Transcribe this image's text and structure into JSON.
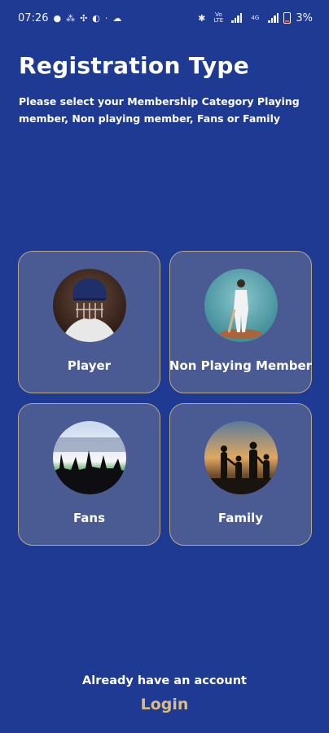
{
  "status_bar": {
    "time": "07:26",
    "network_label": "Vo LTE",
    "network_type": "4G",
    "battery": "3%",
    "left_icons": [
      "message-icon",
      "app-icon",
      "app-icon",
      "whatsapp-icon",
      "dot-icon",
      "cloud-icon"
    ]
  },
  "header": {
    "title": "Registration Type",
    "subtitle": "Please select your Membership Category Playing member, Non playing member, Fans or Family"
  },
  "categories": [
    {
      "label": "Player",
      "icon": "cricket-player-image"
    },
    {
      "label": "Non Playing Member",
      "icon": "cricket-member-image"
    },
    {
      "label": "Fans",
      "icon": "stadium-fans-image"
    },
    {
      "label": "Family",
      "icon": "family-silhouette-image"
    }
  ],
  "footer": {
    "account_text": "Already have an account",
    "login_label": "Login"
  },
  "colors": {
    "background": "#1f3a93",
    "card": "#4a5a93",
    "card_border": "#b6a98a",
    "login_accent": "#d9bb84"
  }
}
